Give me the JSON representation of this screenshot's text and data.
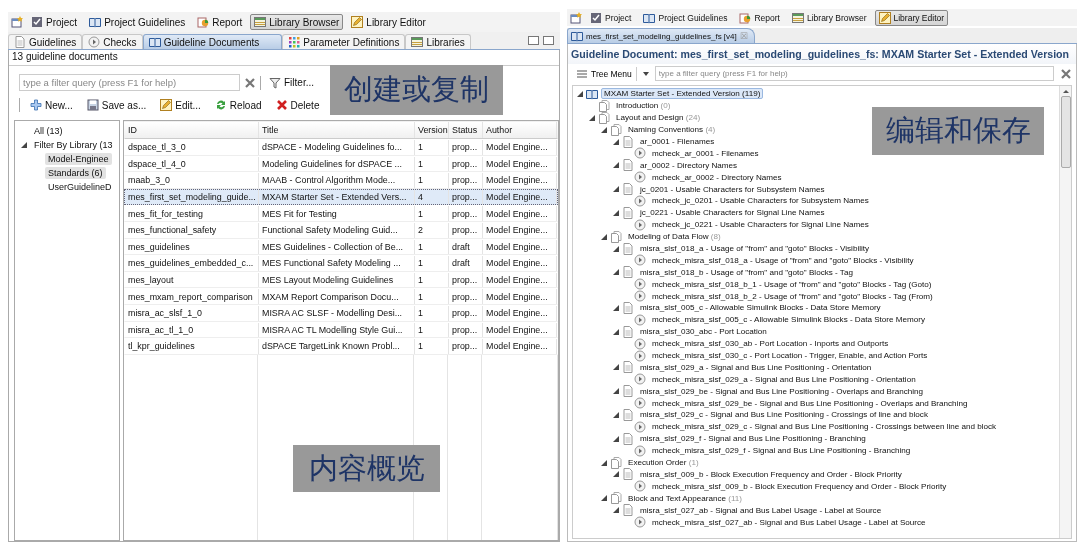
{
  "left_window": {
    "perspectives": [
      {
        "label": "Project",
        "kind": "project",
        "selected": false
      },
      {
        "label": "Project Guidelines",
        "kind": "book",
        "selected": false
      },
      {
        "label": "Report",
        "kind": "report",
        "selected": false
      },
      {
        "label": "Library Browser",
        "kind": "table",
        "selected": true
      },
      {
        "label": "Library Editor",
        "kind": "pencil",
        "selected": false
      }
    ],
    "tabs": [
      {
        "label": "Guidelines",
        "kind": "page",
        "selected": false
      },
      {
        "label": "Checks",
        "kind": "check",
        "selected": false
      },
      {
        "label": "Guideline Documents",
        "kind": "book",
        "selected": true
      },
      {
        "label": "Parameter Definitions",
        "kind": "grid",
        "selected": false
      },
      {
        "label": "Libraries",
        "kind": "table",
        "selected": false
      }
    ],
    "status": "13 guideline documents",
    "filter": {
      "placeholder": "type a filter query (press F1 for help)",
      "button": "Filter..."
    },
    "actions": [
      {
        "label": "New...",
        "kind": "plus"
      },
      {
        "label": "Save as...",
        "kind": "save"
      },
      {
        "label": "Edit...",
        "kind": "pencil"
      },
      {
        "label": "Reload",
        "kind": "reload"
      },
      {
        "label": "Delete",
        "kind": "delete"
      }
    ],
    "library_tree": [
      {
        "label": "All (13)",
        "selected": false
      },
      {
        "label": "Filter By Library (13",
        "selected": false,
        "expanded": true,
        "children": [
          {
            "label": "Model-Enginee",
            "selected": true
          },
          {
            "label": "Standards (6)",
            "selected": true
          },
          {
            "label": "UserGuidelineD",
            "selected": false
          }
        ]
      }
    ],
    "table": {
      "columns": [
        "ID",
        "Title",
        "Version",
        "Status",
        "Author"
      ],
      "rows": [
        {
          "cells": [
            "dspace_tl_3_0",
            "dSPACE - Modeling Guidelines fo...",
            "1",
            "prop...",
            "Model Engine..."
          ],
          "selected": false
        },
        {
          "cells": [
            "dspace_tl_4_0",
            "Modeling Guidelines for dSPACE ...",
            "1",
            "prop...",
            "Model Engine..."
          ],
          "selected": false
        },
        {
          "cells": [
            "maab_3_0",
            "MAAB - Control Algorithm Mode...",
            "1",
            "prop...",
            "Model Engine..."
          ],
          "selected": false
        },
        {
          "cells": [
            "mes_first_set_modeling_guide...",
            "MXAM Starter Set - Extended Vers...",
            "4",
            "prop...",
            "Model Engine..."
          ],
          "selected": true
        },
        {
          "cells": [
            "mes_fit_for_testing",
            "MES Fit for Testing",
            "1",
            "prop...",
            "Model Engine..."
          ],
          "selected": false
        },
        {
          "cells": [
            "mes_functional_safety",
            "Functional Safety Modeling Guid...",
            "2",
            "prop...",
            "Model Engine..."
          ],
          "selected": false
        },
        {
          "cells": [
            "mes_guidelines",
            "MES Guidelines - Collection of Be...",
            "1",
            "draft",
            "Model Engine..."
          ],
          "selected": false
        },
        {
          "cells": [
            "mes_guidelines_embedded_c...",
            "MES Functional Safety Modeling ...",
            "1",
            "draft",
            "Model Engine..."
          ],
          "selected": false
        },
        {
          "cells": [
            "mes_layout",
            "MES Layout Modeling Guidelines",
            "1",
            "prop...",
            "Model Engine..."
          ],
          "selected": false
        },
        {
          "cells": [
            "mes_mxam_report_comparison",
            "MXAM Report Comparison Docu...",
            "1",
            "prop...",
            "Model Engine..."
          ],
          "selected": false
        },
        {
          "cells": [
            "misra_ac_slsf_1_0",
            "MISRA AC SLSF - Modelling Desi...",
            "1",
            "prop...",
            "Model Engine..."
          ],
          "selected": false
        },
        {
          "cells": [
            "misra_ac_tl_1_0",
            "MISRA AC TL Modelling Style Gui...",
            "1",
            "prop...",
            "Model Engine..."
          ],
          "selected": false
        },
        {
          "cells": [
            "tl_kpr_guidelines",
            "dSPACE TargetLink Known Probl...",
            "1",
            "prop...",
            "Model Engine..."
          ],
          "selected": false
        }
      ]
    },
    "callouts": [
      "创建或复制",
      "内容概览"
    ]
  },
  "right_window": {
    "perspectives": [
      {
        "label": "Project",
        "kind": "project",
        "selected": false
      },
      {
        "label": "Project Guidelines",
        "kind": "book",
        "selected": false
      },
      {
        "label": "Report",
        "kind": "report",
        "selected": false
      },
      {
        "label": "Library Browser",
        "kind": "table",
        "selected": false
      },
      {
        "label": "Library Editor",
        "kind": "pencil",
        "selected": true
      }
    ],
    "editor_tab": {
      "label": "mes_first_set_modeling_guidelines_fs [v4]",
      "close": "☒"
    },
    "heading": "Guideline Document: mes_first_set_modeling_guidelines_fs: MXAM Starter Set - Extended Version",
    "tree_menu": "Tree Menu",
    "filter": {
      "placeholder": "type a filter query (press F1 for help)"
    },
    "callout": "编辑和保存",
    "tree": [
      {
        "kind": "book",
        "label": "MXAM Starter Set - Extended Version (119)",
        "selected": true,
        "expanded": true,
        "children": [
          {
            "kind": "section",
            "label": "Introduction",
            "count": "(0)",
            "selected": false
          },
          {
            "kind": "section",
            "label": "Layout and Design",
            "count": "(24)",
            "selected": false,
            "expanded": true,
            "children": [
              {
                "kind": "section",
                "label": "Naming Conventions",
                "count": "(4)",
                "selected": false,
                "expanded": true,
                "children": [
                  {
                    "kind": "guideline",
                    "label": "ar_0001 - Filenames",
                    "selected": false,
                    "expanded": true,
                    "children": [
                      {
                        "kind": "check",
                        "label": "mcheck_ar_0001 - Filenames",
                        "selected": false
                      }
                    ]
                  },
                  {
                    "kind": "guideline",
                    "label": "ar_0002 - Directory Names",
                    "selected": false,
                    "expanded": true,
                    "children": [
                      {
                        "kind": "check",
                        "label": "mcheck_ar_0002 - Directory Names",
                        "selected": false
                      }
                    ]
                  },
                  {
                    "kind": "guideline",
                    "label": "jc_0201 - Usable Characters for Subsystem Names",
                    "selected": false,
                    "expanded": true,
                    "children": [
                      {
                        "kind": "check",
                        "label": "mcheck_jc_0201 - Usable Characters for Subsystem Names",
                        "selected": false
                      }
                    ]
                  },
                  {
                    "kind": "guideline",
                    "label": "jc_0221 - Usable Characters for Signal Line Names",
                    "selected": false,
                    "expanded": true,
                    "children": [
                      {
                        "kind": "check",
                        "label": "mcheck_jc_0221 - Usable Characters for Signal Line Names",
                        "selected": false
                      }
                    ]
                  }
                ]
              },
              {
                "kind": "section",
                "label": "Modeling of Data Flow",
                "count": "(8)",
                "selected": false,
                "expanded": true,
                "children": [
                  {
                    "kind": "guideline",
                    "label": "misra_slsf_018_a - Usage of \"from\" and \"goto\" Blocks - Visibility",
                    "selected": false,
                    "expanded": true,
                    "children": [
                      {
                        "kind": "check",
                        "label": "mcheck_misra_slsf_018_a - Usage of \"from\" and \"goto\" Blocks - Visibility",
                        "selected": false
                      }
                    ]
                  },
                  {
                    "kind": "guideline",
                    "label": "misra_slsf_018_b - Usage of \"from\" and \"goto\" Blocks - Tag",
                    "selected": false,
                    "expanded": true,
                    "children": [
                      {
                        "kind": "check",
                        "label": "mcheck_misra_slsf_018_b_1 - Usage of \"from\" and \"goto\" Blocks - Tag (Goto)",
                        "selected": false
                      },
                      {
                        "kind": "check",
                        "label": "mcheck_misra_slsf_018_b_2 - Usage of \"from\" and \"goto\" Blocks - Tag (From)",
                        "selected": false
                      }
                    ]
                  },
                  {
                    "kind": "guideline",
                    "label": "misra_slsf_005_c - Allowable Simulink Blocks - Data Store Memory",
                    "selected": false,
                    "expanded": true,
                    "children": [
                      {
                        "kind": "check",
                        "label": "mcheck_misra_slsf_005_c - Allowable Simulink Blocks - Data Store Memory",
                        "selected": false
                      }
                    ]
                  },
                  {
                    "kind": "guideline",
                    "label": "misra_slsf_030_abc - Port Location",
                    "selected": false,
                    "expanded": true,
                    "children": [
                      {
                        "kind": "check",
                        "label": "mcheck_misra_slsf_030_ab - Port Location - Inports and Outports",
                        "selected": false
                      },
                      {
                        "kind": "check",
                        "label": "mcheck_misra_slsf_030_c - Port Location - Trigger, Enable, and Action Ports",
                        "selected": false
                      }
                    ]
                  },
                  {
                    "kind": "guideline",
                    "label": "misra_slsf_029_a - Signal and Bus Line Positioning - Orientation",
                    "selected": false,
                    "expanded": true,
                    "children": [
                      {
                        "kind": "check",
                        "label": "mcheck_misra_slsf_029_a - Signal and Bus Line Positioning - Orientation",
                        "selected": false
                      }
                    ]
                  },
                  {
                    "kind": "guideline",
                    "label": "misra_slsf_029_be - Signal and Bus Line Positioning - Overlaps and Branching",
                    "selected": false,
                    "expanded": true,
                    "children": [
                      {
                        "kind": "check",
                        "label": "mcheck_misra_slsf_029_be - Signal and Bus Line Positioning - Overlaps and Branching",
                        "selected": false
                      }
                    ]
                  },
                  {
                    "kind": "guideline",
                    "label": "misra_slsf_029_c - Signal and Bus Line Positioning - Crossings of line and block",
                    "selected": false,
                    "expanded": true,
                    "children": [
                      {
                        "kind": "check",
                        "label": "mcheck_misra_slsf_029_c - Signal and Bus Line Positioning - Crossings between line and block",
                        "selected": false
                      }
                    ]
                  },
                  {
                    "kind": "guideline",
                    "label": "misra_slsf_029_f - Signal and Bus Line Positioning - Branching",
                    "selected": false,
                    "expanded": true,
                    "children": [
                      {
                        "kind": "check",
                        "label": "mcheck_misra_slsf_029_f - Signal and Bus Line Positioning - Branching",
                        "selected": false
                      }
                    ]
                  }
                ]
              },
              {
                "kind": "section",
                "label": "Execution Order",
                "count": "(1)",
                "selected": false,
                "expanded": true,
                "children": [
                  {
                    "kind": "guideline",
                    "label": "misra_slsf_009_b - Block Execution Frequency and Order - Block Priority",
                    "selected": false,
                    "expanded": true,
                    "children": [
                      {
                        "kind": "check",
                        "label": "mcheck_misra_slsf_009_b - Block Execution Frequency and Order - Block Priority",
                        "selected": false
                      }
                    ]
                  }
                ]
              },
              {
                "kind": "section",
                "label": "Block and Text Appearance",
                "count": "(11)",
                "selected": false,
                "expanded": true,
                "children": [
                  {
                    "kind": "guideline",
                    "label": "misra_slsf_027_ab - Signal and Bus Label Usage - Label at Source",
                    "selected": false,
                    "expanded": true,
                    "children": [
                      {
                        "kind": "check",
                        "label": "mcheck_misra_slsf_027_ab - Signal and Bus Label Usage - Label at Source",
                        "selected": false
                      }
                    ]
                  }
                ]
              }
            ]
          }
        ]
      }
    ]
  }
}
